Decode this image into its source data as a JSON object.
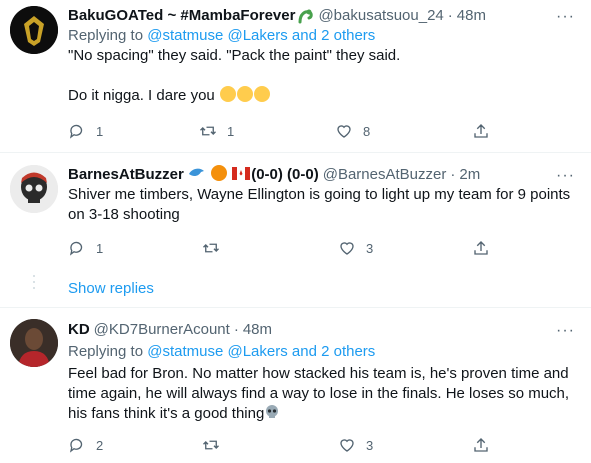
{
  "tweets": [
    {
      "name": "BakuGOATed ~ #MambaForever",
      "handle": "@bakusatsuou_24",
      "time": "48m",
      "replying_prefix": "Replying to ",
      "replying_user": "@statmuse",
      "replying_others": "@Lakers and 2 others",
      "body": "\"No spacing\" they said. \"Pack the paint\" they said.\n\nDo it nigga. I dare you",
      "reply_count": "1",
      "retweet_count": "1",
      "like_count": "8"
    },
    {
      "name": "BarnesAtBuzzer",
      "name_suffix": "(0-0) (0-0)",
      "handle": "@BarnesAtBuzzer",
      "time": "2m",
      "body": "Shiver me timbers, Wayne Ellington is going to light up my team for 9 points on 3-18 shooting",
      "reply_count": "1",
      "retweet_count": "",
      "like_count": "3",
      "show_replies": "Show replies"
    },
    {
      "name": "KD",
      "handle": "@KD7BurnerAcount",
      "time": "48m",
      "replying_prefix": "Replying to ",
      "replying_user": "@statmuse",
      "replying_others": "@Lakers and 2 others",
      "body": "Feel bad for Bron. No matter how stacked his team is, he's proven time and time again, he will always find a way to lose in the finals. He loses so much, his fans think it's a good thing",
      "reply_count": "2",
      "retweet_count": "",
      "like_count": "3"
    }
  ],
  "separator": "·",
  "more_label": "···",
  "colors": {
    "link": "#1d9bf0",
    "secondary": "#536471",
    "text": "#0f1419",
    "divider": "#eff3f4"
  }
}
